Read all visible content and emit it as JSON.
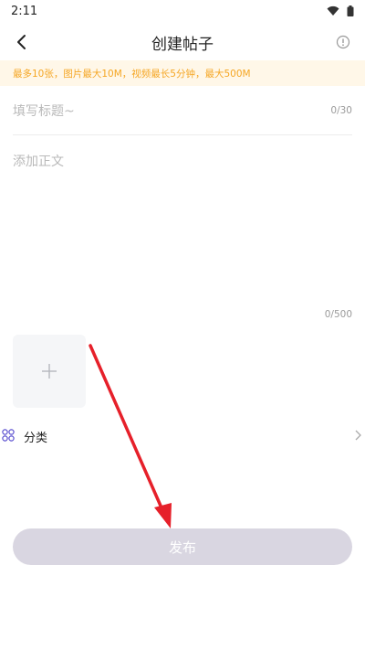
{
  "status_bar": {
    "time": "2:11",
    "wifi_icon": "wifi-icon",
    "battery_icon": "battery-icon"
  },
  "header": {
    "title": "创建帖子",
    "back_icon": "chevron-left-icon",
    "info_icon": "info-circle-icon"
  },
  "notice": {
    "text": "最多10张，图片最大10M，视频最长5分钟，最大500M"
  },
  "form": {
    "title_placeholder": "填写标题~",
    "title_value": "",
    "title_count": "0/30",
    "body_placeholder": "添加正文",
    "body_value": "",
    "body_count": "0/500",
    "add_media_icon": "plus-icon"
  },
  "category": {
    "label": "分类",
    "icon": "category-icon",
    "chevron": "chevron-right-icon"
  },
  "publish": {
    "label": "发布"
  },
  "colors": {
    "notice_bg": "#fff7e8",
    "notice_text": "#f5a623",
    "publish_bg": "#d9d6e1",
    "category_icon": "#5a4fcf",
    "arrow": "#e6202a"
  }
}
